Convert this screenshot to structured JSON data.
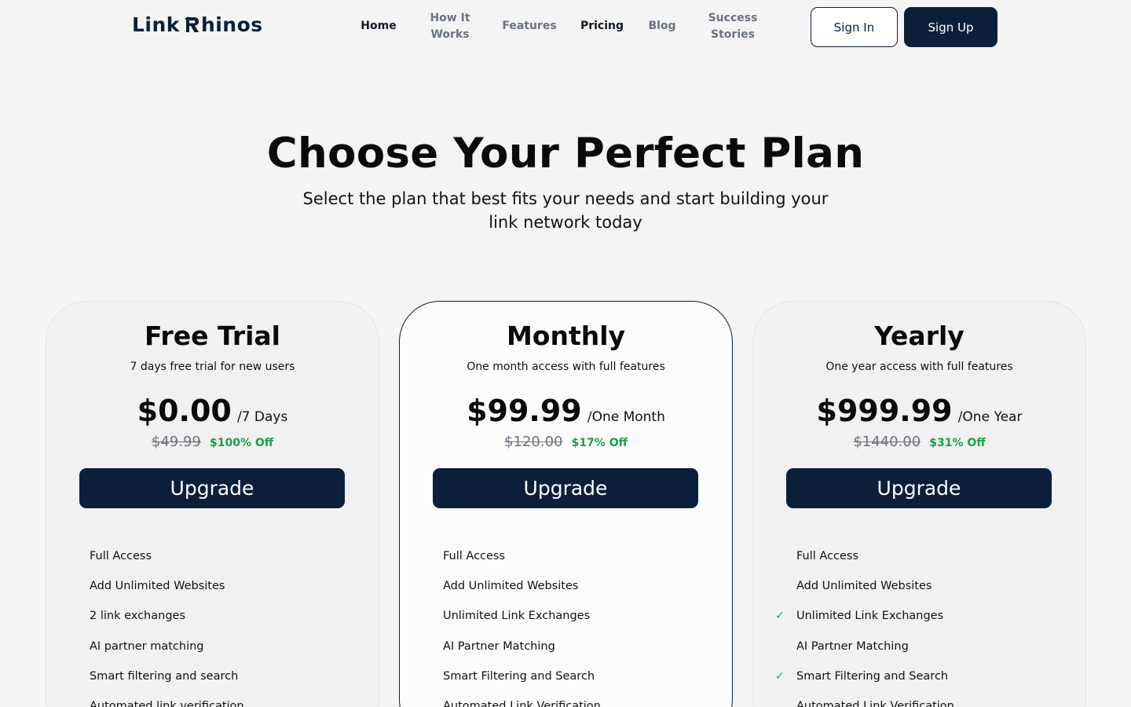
{
  "brand": {
    "part1": "Link",
    "part2": "hinos"
  },
  "nav": [
    {
      "label": "Home",
      "active": true
    },
    {
      "label": "How It Works",
      "active": false
    },
    {
      "label": "Features",
      "active": false
    },
    {
      "label": "Pricing",
      "active": true
    },
    {
      "label": "Blog",
      "active": false
    },
    {
      "label": "Success Stories",
      "active": false
    }
  ],
  "auth": {
    "signin": "Sign In",
    "signup": "Sign Up"
  },
  "hero": {
    "title": "Choose Your Perfect Plan",
    "subtitle": "Select the plan that best fits your needs and start building your link network today"
  },
  "colors": {
    "navy": "#0b1f3a",
    "green": "#16a34a",
    "muted": "#6b7280",
    "background": "#f4f4f4"
  },
  "plans": [
    {
      "name": "Free Trial",
      "description": "7 days free trial for new users",
      "price": "$0.00",
      "period": "/7 Days",
      "old_price": "$49.99",
      "discount": "$100% Off",
      "cta": "Upgrade",
      "features": [
        {
          "label": "Full Access",
          "check": false
        },
        {
          "label": "Add Unlimited Websites",
          "check": false
        },
        {
          "label": "2 link exchanges",
          "check": false
        },
        {
          "label": "AI partner matching",
          "check": false
        },
        {
          "label": "Smart filtering and search",
          "check": false
        },
        {
          "label": "Automated link verification",
          "check": false
        }
      ]
    },
    {
      "name": "Monthly",
      "description": "One month access with full features",
      "price": "$99.99",
      "period": "/One Month",
      "old_price": "$120.00",
      "discount": "$17% Off",
      "cta": "Upgrade",
      "features": [
        {
          "label": "Full Access",
          "check": false
        },
        {
          "label": "Add Unlimited Websites",
          "check": false
        },
        {
          "label": "Unlimited Link Exchanges",
          "check": false
        },
        {
          "label": "AI Partner Matching",
          "check": false
        },
        {
          "label": "Smart Filtering and Search",
          "check": false
        },
        {
          "label": "Automated Link Verification",
          "check": false
        }
      ]
    },
    {
      "name": "Yearly",
      "description": "One year access with full features",
      "price": "$999.99",
      "period": "/One Year",
      "old_price": "$1440.00",
      "discount": "$31% Off",
      "cta": "Upgrade",
      "features": [
        {
          "label": "Full Access",
          "check": false
        },
        {
          "label": "Add Unlimited Websites",
          "check": false
        },
        {
          "label": "Unlimited Link Exchanges",
          "check": true
        },
        {
          "label": "AI Partner Matching",
          "check": false
        },
        {
          "label": "Smart Filtering and Search",
          "check": true
        },
        {
          "label": "Automated Link Verification",
          "check": false
        }
      ]
    }
  ]
}
